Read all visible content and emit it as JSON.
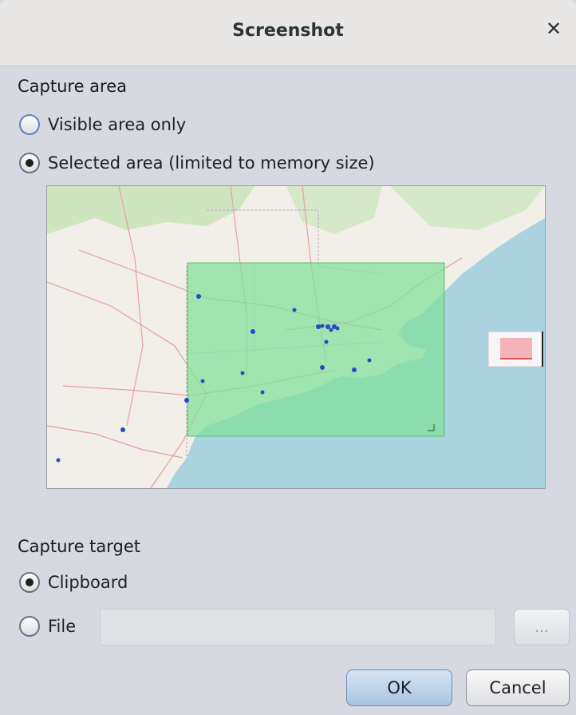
{
  "dialog": {
    "title": "Screenshot",
    "close_icon": "close-icon"
  },
  "capture_area": {
    "label": "Capture area",
    "options": [
      {
        "label": "Visible area only",
        "selected": false
      },
      {
        "label": "Selected area (limited to memory size)",
        "selected": true
      }
    ]
  },
  "capture_target": {
    "label": "Capture target",
    "options": [
      {
        "label": "Clipboard",
        "selected": true
      },
      {
        "label": "File",
        "selected": false
      }
    ],
    "file_path_value": "",
    "browse_label": "..."
  },
  "buttons": {
    "ok": "OK",
    "cancel": "Cancel"
  },
  "colors": {
    "selection_fill": "#7fe09a",
    "water": "#aad3df",
    "land": "#f2efe9",
    "accent": "#5b84c2"
  }
}
